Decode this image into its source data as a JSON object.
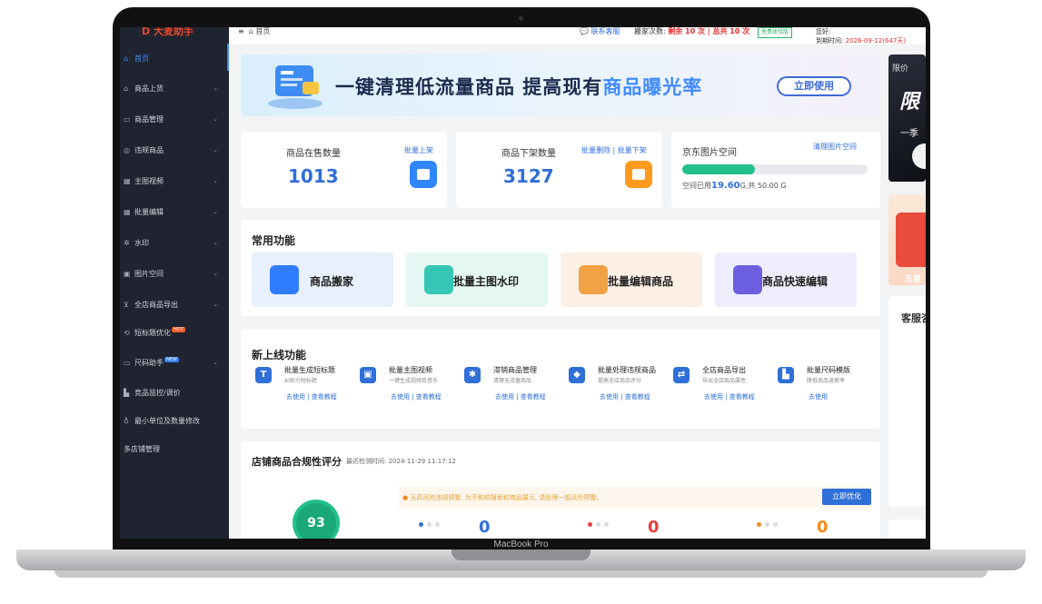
{
  "device": {
    "label": "MacBook Pro"
  },
  "sidebar": {
    "logo": "大麦助手",
    "items": [
      {
        "label": "首页",
        "icon": "home-icon",
        "glyph": "⌂",
        "has_chevron": false,
        "active": true
      },
      {
        "label": "商品上货",
        "icon": "upload-icon",
        "glyph": "⌂",
        "has_chevron": true
      },
      {
        "label": "商品管理",
        "icon": "doc-icon",
        "glyph": "▭",
        "has_chevron": true
      },
      {
        "label": "违规商品",
        "icon": "warning-icon",
        "glyph": "◎",
        "has_chevron": true
      },
      {
        "label": "主图视频",
        "icon": "video-icon",
        "glyph": "▦",
        "has_chevron": true
      },
      {
        "label": "批量编辑",
        "icon": "grid-icon",
        "glyph": "▦",
        "has_chevron": true
      },
      {
        "label": "水印",
        "icon": "watermark-icon",
        "glyph": "✲",
        "has_chevron": true
      },
      {
        "label": "图片空间",
        "icon": "image-icon",
        "glyph": "▣",
        "has_chevron": true
      },
      {
        "label": "全店商品导出",
        "icon": "export-icon",
        "glyph": "⊻",
        "has_chevron": true
      },
      {
        "label": "短标题优化",
        "icon": "title-icon",
        "glyph": "⟲",
        "has_chevron": false,
        "badge": "HOT"
      },
      {
        "label": "尺码助手",
        "icon": "size-icon",
        "glyph": "▭",
        "has_chevron": true,
        "badge": "NEW"
      },
      {
        "label": "竞品监控/调价",
        "icon": "chart-icon",
        "glyph": "▙",
        "has_chevron": false
      },
      {
        "label": "最小单位及数量修改",
        "icon": "unit-icon",
        "glyph": "♁",
        "has_chevron": false
      },
      {
        "label": "多店铺管理",
        "icon": "",
        "glyph": "",
        "has_chevron": false
      }
    ]
  },
  "topbar": {
    "menu_glyph": "≡",
    "breadcrumb": "首页",
    "contact": "联系客服",
    "quota_label": "搬家次数:",
    "quota_remaining": "剩余 10 次",
    "quota_total": "总共 10 次",
    "trial_badge": "免费体验版",
    "user_label": "您好:",
    "expire_label": "到期时间:",
    "expire_value": "2026-09-12(647天)"
  },
  "banner": {
    "text_main": "一键清理低流量商品  提高现有",
    "text_highlight": "商品曝光率",
    "button": "立即使用"
  },
  "promo": {
    "p1_small": "限价",
    "p1_big": "限",
    "p1_line": "一季",
    "p2_text": "五星",
    "kefu_title": "客服咨"
  },
  "stats": {
    "on_sale": {
      "title": "商品在售数量",
      "value": "1013",
      "link": "批量上架"
    },
    "off_sale": {
      "title": "商品下架数量",
      "value": "3127",
      "link": "批量删除 | 批量下架"
    },
    "images": {
      "title": "京东图片空间",
      "link": "清理图片空间",
      "used_prefix": "空间已用",
      "used_value": "19.60",
      "used_suffix": "G,共 50.00 G",
      "used_fraction": 0.39
    }
  },
  "common": {
    "title": "常用功能",
    "tiles": [
      {
        "label": "商品搬家",
        "bg": "#e7f0fc",
        "icon_color": "#2f7cff",
        "icon": "briefcase-icon"
      },
      {
        "label": "批量主图水印",
        "bg": "#e5f7f3",
        "icon_color": "#35c6b6",
        "icon": "image-stack-icon"
      },
      {
        "label": "批量编辑商品",
        "bg": "#fcefe3",
        "icon_color": "#f1a244",
        "icon": "edit-icon"
      },
      {
        "label": "商品快速编辑",
        "bg": "#efedfb",
        "icon_color": "#6b5fe0",
        "icon": "quick-edit-icon"
      }
    ]
  },
  "newfeatures": {
    "title": "新上线功能",
    "items": [
      {
        "title": "批量生成短标题",
        "desc": "AI助力短标题",
        "links": "去使用 | 查看教程",
        "glyph": "T",
        "color": "#2f6fd8",
        "icon": "text-icon"
      },
      {
        "title": "批量主图视频",
        "desc": "一键生成视频及音乐",
        "links": "去使用 | 查看教程",
        "glyph": "▣",
        "color": "#2f6fd8",
        "icon": "video-edit-icon"
      },
      {
        "title": "滞销商品管理",
        "desc": "清理无流量商品",
        "links": "去使用 | 查看教程",
        "glyph": "✱",
        "color": "#2f6fd8",
        "icon": "puzzle-icon"
      },
      {
        "title": "批量处理违规商品",
        "desc": "提高全店商品评分",
        "links": "去使用 | 查看教程",
        "glyph": "◆",
        "color": "#2f6fd8",
        "icon": "shield-icon"
      },
      {
        "title": "全店商品导出",
        "desc": "导出全店商品属性",
        "links": "去使用 | 查看教程",
        "glyph": "⇄",
        "color": "#2f6fd8",
        "icon": "export-icon"
      },
      {
        "title": "批量尺码模版",
        "desc": "降低商品退换率",
        "links": "去使用",
        "glyph": "▙",
        "color": "#2f6fd8",
        "icon": "size-chart-icon"
      }
    ]
  },
  "compliance": {
    "title": "店铺商品合规性评分",
    "time_label": "最近检测时间: 2024-11-29 11:17:12",
    "warning": "无高风险违规预警, 为不影响搜索和商品展示, 请处理一般风险预警。",
    "button": "立即优化",
    "score": "93",
    "risks": [
      {
        "value": "0",
        "color": "#2f6fd8"
      },
      {
        "value": "0",
        "color": "#e53e3e"
      },
      {
        "value": "0",
        "color": "#f08c1b"
      }
    ]
  }
}
